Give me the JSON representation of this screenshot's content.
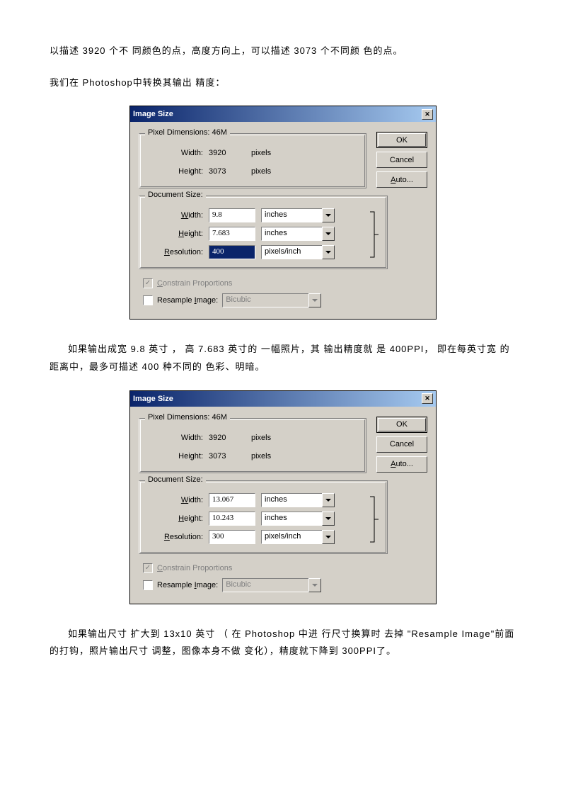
{
  "text": {
    "p1": "以描述 3920 个不 同颜色的点，高度方向上，可以描述    3073 个不同颜 色的点。",
    "p2": "我们在  Photoshop中转换其输出  精度：",
    "p3": "如果输出成宽  9.8 英寸 ， 高  7.683 英寸的  一幅照片，其 输出精度就    是  400PPI， 即在每英寸宽 的距离中，最多可描述    400 种不同的  色彩、明暗。",
    "p4": "如果输出尺寸  扩大到  13x10 英寸 （ 在  Photoshop 中进 行尺寸换算时   去掉 \"Resample Image\"前面的打钩，照片输出尺寸    调整，图像本身不做    变化），精度就下降到    300PPI了。"
  },
  "dialog1": {
    "title": "Image Size",
    "pixelDim": {
      "legend": "Pixel Dimensions:  46M",
      "widthLabel": "Width:",
      "widthVal": "3920",
      "widthUnit": "pixels",
      "heightLabel": "Height:",
      "heightVal": "3073",
      "heightUnit": "pixels"
    },
    "docSize": {
      "legend": "Document Size:",
      "widthLabel": "Width:",
      "widthVal": "9.8",
      "widthUnit": "inches",
      "heightLabel": "Height:",
      "heightVal": "7.683",
      "heightUnit": "inches",
      "resLabel": "Resolution:",
      "resVal": "400",
      "resUnit": "pixels/inch"
    },
    "constrain": "Constrain Proportions",
    "resample": "Resample Image:",
    "resampleMethod": "Bicubic",
    "buttons": {
      "ok": "OK",
      "cancel": "Cancel",
      "auto": "Auto..."
    }
  },
  "dialog2": {
    "title": "Image Size",
    "pixelDim": {
      "legend": "Pixel Dimensions:  46M",
      "widthLabel": "Width:",
      "widthVal": "3920",
      "widthUnit": "pixels",
      "heightLabel": "Height:",
      "heightVal": "3073",
      "heightUnit": "pixels"
    },
    "docSize": {
      "legend": "Document Size:",
      "widthLabel": "Width:",
      "widthVal": "13.067",
      "widthUnit": "inches",
      "heightLabel": "Height:",
      "heightVal": "10.243",
      "heightUnit": "inches",
      "resLabel": "Resolution:",
      "resVal": "300",
      "resUnit": "pixels/inch"
    },
    "constrain": "Constrain Proportions",
    "resample": "Resample Image:",
    "resampleMethod": "Bicubic",
    "buttons": {
      "ok": "OK",
      "cancel": "Cancel",
      "auto": "Auto..."
    }
  }
}
